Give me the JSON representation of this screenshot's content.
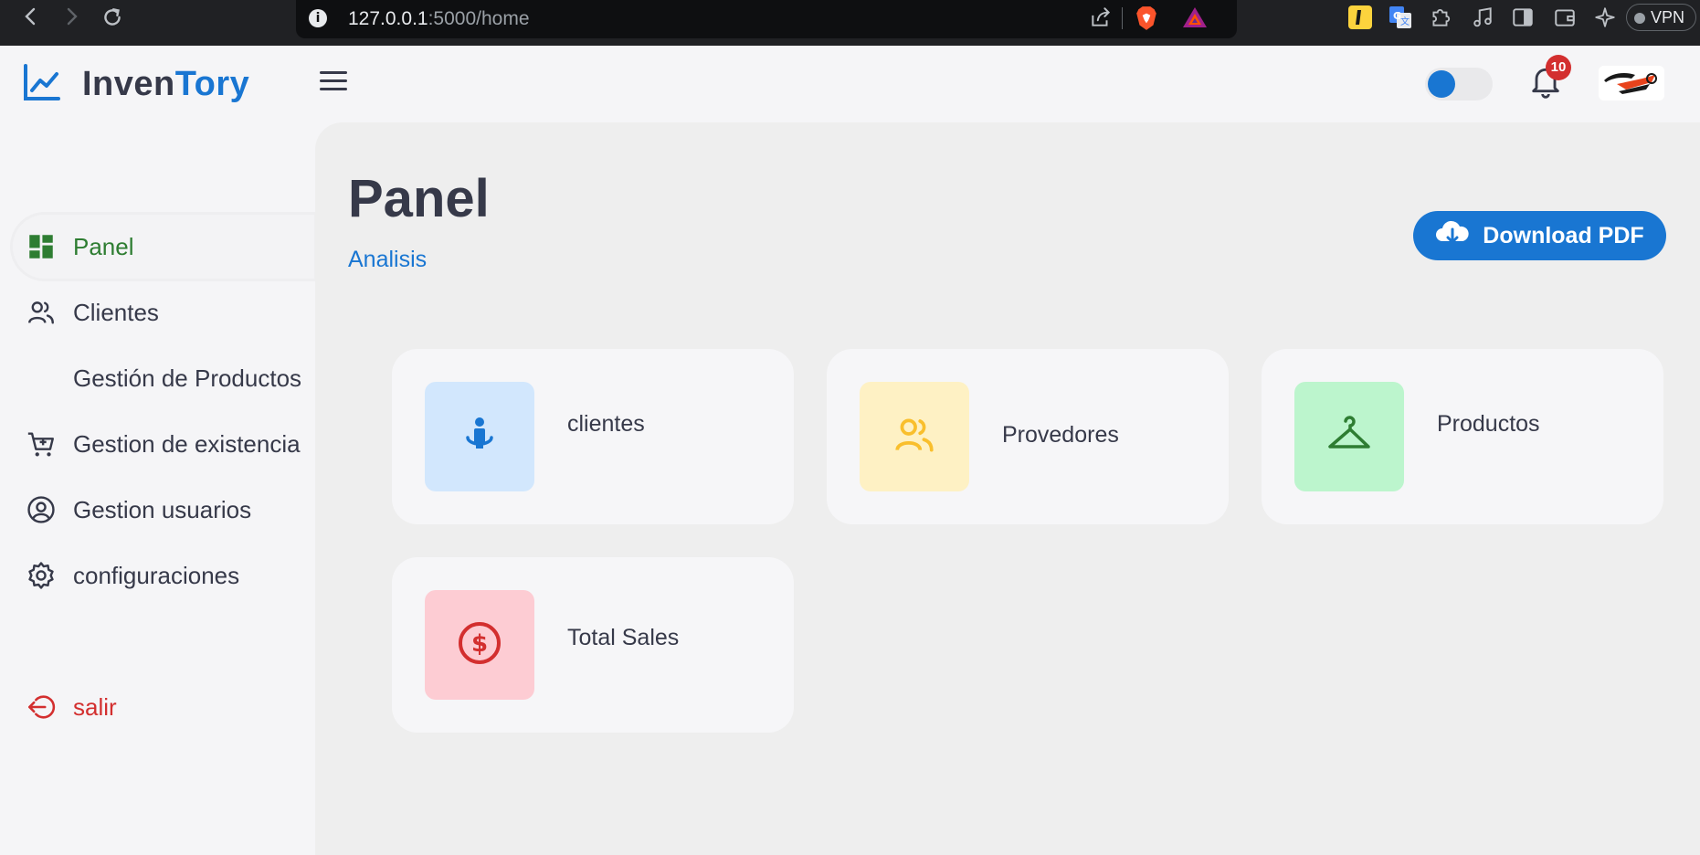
{
  "browser": {
    "url_host": "127.0.0.1",
    "url_path": ":5000/home",
    "vpn_label": "VPN",
    "icons": [
      "back-arrow-icon",
      "forward-arrow-icon",
      "reload-icon",
      "site-info-icon",
      "share-icon",
      "brave-shields-icon",
      "brave-rewards-icon",
      "extension-l-icon",
      "translate-icon",
      "extensions-puzzle-icon",
      "music-icon",
      "sidebar-icon",
      "wallet-icon",
      "leo-ai-icon"
    ]
  },
  "header": {
    "brand_part1": "Inven",
    "brand_part2": "Tory",
    "notification_count": "10",
    "theme_toggle_on": true
  },
  "sidebar": {
    "items": [
      {
        "label": "Panel",
        "icon": "dashboard-icon",
        "active": true
      },
      {
        "label": "Clientes",
        "icon": "users-icon"
      },
      {
        "label": "Gestión de Productos",
        "icon": ""
      },
      {
        "label": "Gestion de existencia",
        "icon": "cart-add-icon"
      },
      {
        "label": "Gestion usuarios",
        "icon": "user-circle-icon"
      },
      {
        "label": "configuraciones",
        "icon": "gear-icon"
      }
    ],
    "logout": {
      "label": "salir",
      "icon": "logout-icon"
    }
  },
  "main": {
    "title": "Panel",
    "subtitle": "Analisis",
    "download_label": "Download PDF",
    "cards": [
      {
        "label": "clientes",
        "icon": "person-location-icon",
        "tile_color": "#d2e7fd",
        "icon_color": "#1976d2"
      },
      {
        "label": "Provedores",
        "icon": "users-icon",
        "tile_color": "#fef1c4",
        "icon_color": "#f9bf2d"
      },
      {
        "label": "Productos",
        "icon": "hanger-icon",
        "tile_color": "#bcf5cd",
        "icon_color": "#2e7d32"
      },
      {
        "label": "Total Sales",
        "icon": "dollar-circle-icon",
        "tile_color": "#fdccd3",
        "icon_color": "#d32f2f"
      }
    ]
  },
  "colors": {
    "accent": "#1976d2",
    "active": "#2e7d32",
    "danger": "#d32f2f",
    "text": "#363949"
  }
}
